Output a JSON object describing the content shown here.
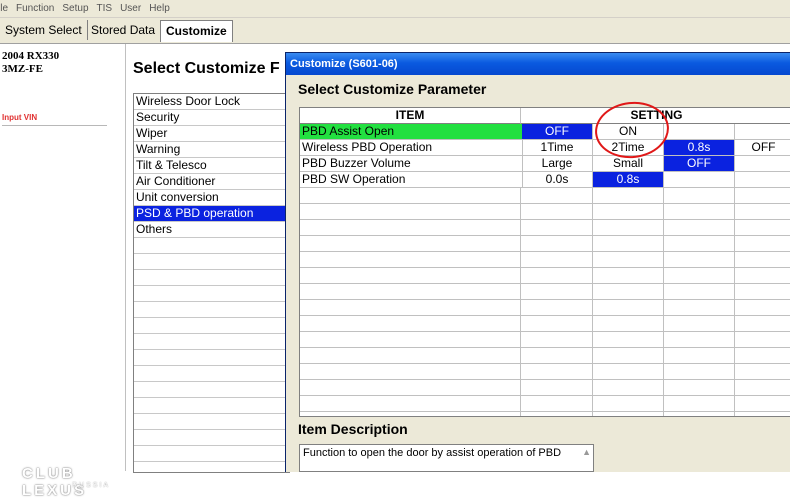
{
  "menu": [
    "ile",
    "Function",
    "Setup",
    "TIS",
    "User",
    "Help"
  ],
  "tabs": [
    "System Select",
    "Stored Data",
    "Customize"
  ],
  "vehicle": {
    "line1": "2004 RX330",
    "line2": "3MZ-FE"
  },
  "input_vin": "Input VIN",
  "background": {
    "heading": "Select Customize F",
    "items": [
      "Wireless Door Lock",
      "Security",
      "Wiper",
      "Warning",
      "Tilt & Telesco",
      "Air Conditioner",
      "Unit conversion",
      "PSD & PBD operation",
      "Others"
    ],
    "selected_index": 7
  },
  "dialog": {
    "title": "Customize (S601-06)",
    "heading": "Select Customize Parameter",
    "col_item": "ITEM",
    "col_setting": "SETTING",
    "rows": [
      {
        "item": "PBD Assist Open",
        "settings": [
          "OFF",
          "ON",
          "",
          ""
        ]
      },
      {
        "item": "Wireless PBD Operation",
        "settings": [
          "1Time",
          "2Time",
          "0.8s",
          "OFF"
        ]
      },
      {
        "item": "PBD Buzzer Volume",
        "settings": [
          "Large",
          "Small",
          "OFF",
          ""
        ]
      },
      {
        "item": "PBD SW Operation",
        "settings": [
          "0.0s",
          "0.8s",
          "",
          ""
        ]
      }
    ],
    "description_heading": "Item Description",
    "description": "Function to open the door by assist operation of PBD"
  },
  "watermark": {
    "main": "CLUB LEXUS",
    "sub": "RUSSIA"
  },
  "colors": {
    "selected": "#0a22e0",
    "item_highlight": "#22e040",
    "annotation": "#e01818",
    "titlebar": "#0a5ae0"
  }
}
